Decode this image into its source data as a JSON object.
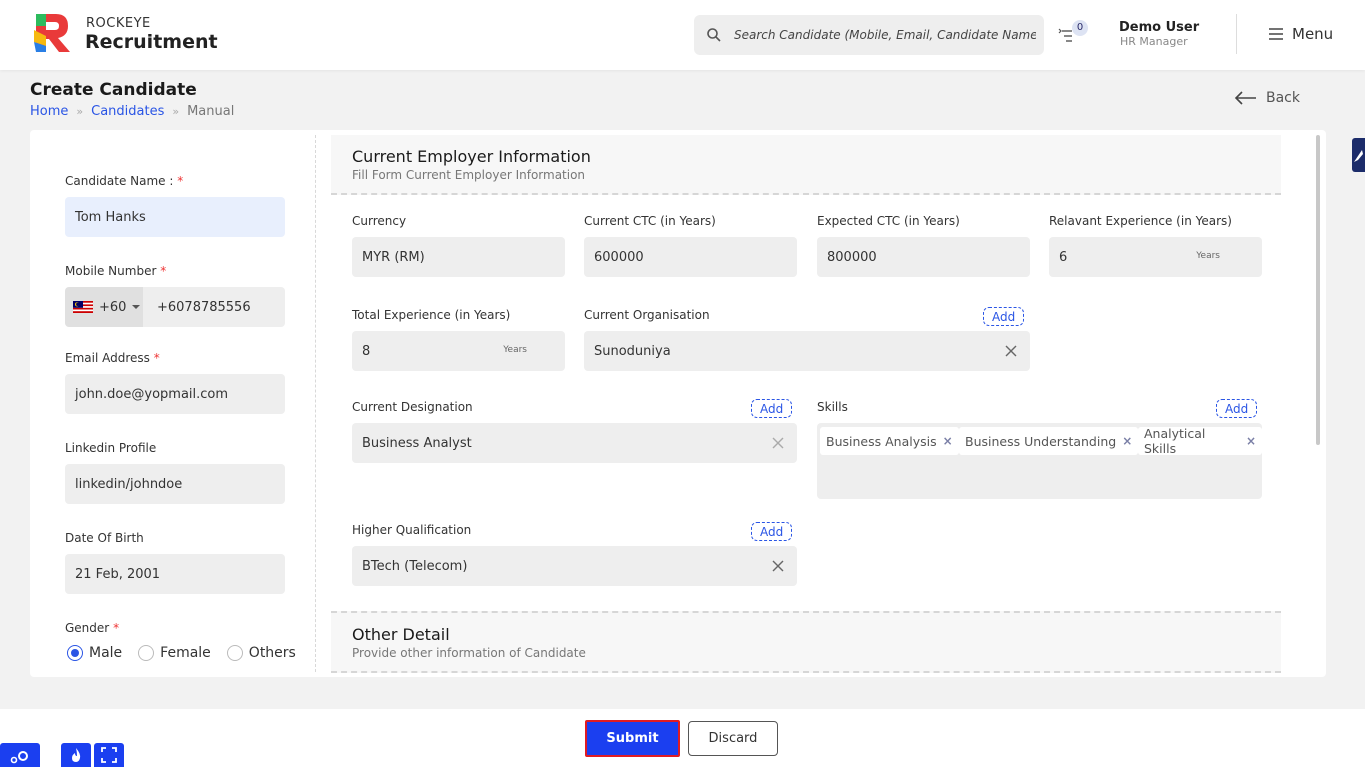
{
  "header": {
    "brand_top": "ROCKEYE",
    "brand_main": "Recruitment",
    "search_placeholder": "Search Candidate (Mobile, Email, Candidate Name)",
    "notification_count": "0",
    "user_name": "Demo User",
    "user_role": "HR Manager",
    "menu_label": "Menu"
  },
  "page": {
    "title": "Create Candidate",
    "breadcrumb": [
      "Home",
      "Candidates",
      "Manual"
    ],
    "back_label": "Back"
  },
  "left_form": {
    "candidate_name_label": "Candidate Name :",
    "candidate_name_value": "Tom Hanks",
    "mobile_label": "Mobile Number",
    "mobile_code": "+60",
    "mobile_value": "+6078785556",
    "email_label": "Email Address",
    "email_value": "john.doe@yopmail.com",
    "linkedin_label": "Linkedin Profile",
    "linkedin_value": "linkedin/johndoe",
    "dob_label": "Date Of Birth",
    "dob_value": "21 Feb, 2001",
    "gender_label": "Gender",
    "gender_options": [
      "Male",
      "Female",
      "Others"
    ],
    "gender_selected": "Male",
    "required_mark": "*"
  },
  "employer_section": {
    "title": "Current Employer Information",
    "subtitle": "Fill Form Current Employer Information",
    "currency_label": "Currency",
    "currency_value": "MYR (RM)",
    "current_ctc_label": "Current CTC (in Years)",
    "current_ctc_value": "600000",
    "expected_ctc_label": "Expected CTC (in Years)",
    "expected_ctc_value": "800000",
    "relevant_exp_label": "Relavant Experience (in Years)",
    "relevant_exp_value": "6",
    "years_unit": "Years",
    "total_exp_label": "Total Experience (in Years)",
    "total_exp_value": "8",
    "organisation_label": "Current Organisation",
    "organisation_value": "Sunoduniya",
    "designation_label": "Current Designation",
    "designation_value": "Business Analyst",
    "skills_label": "Skills",
    "skills": [
      "Business Analysis",
      "Business Understanding",
      "Analytical Skills"
    ],
    "qualification_label": "Higher Qualification",
    "qualification_value": "BTech (Telecom)",
    "add_label": "Add"
  },
  "other_section": {
    "title": "Other Detail",
    "subtitle": "Provide other information of Candidate"
  },
  "footer": {
    "submit_label": "Submit",
    "discard_label": "Discard"
  },
  "colors": {
    "primary": "#1b3ff0",
    "link": "#2a55e5",
    "required": "#e33333"
  }
}
